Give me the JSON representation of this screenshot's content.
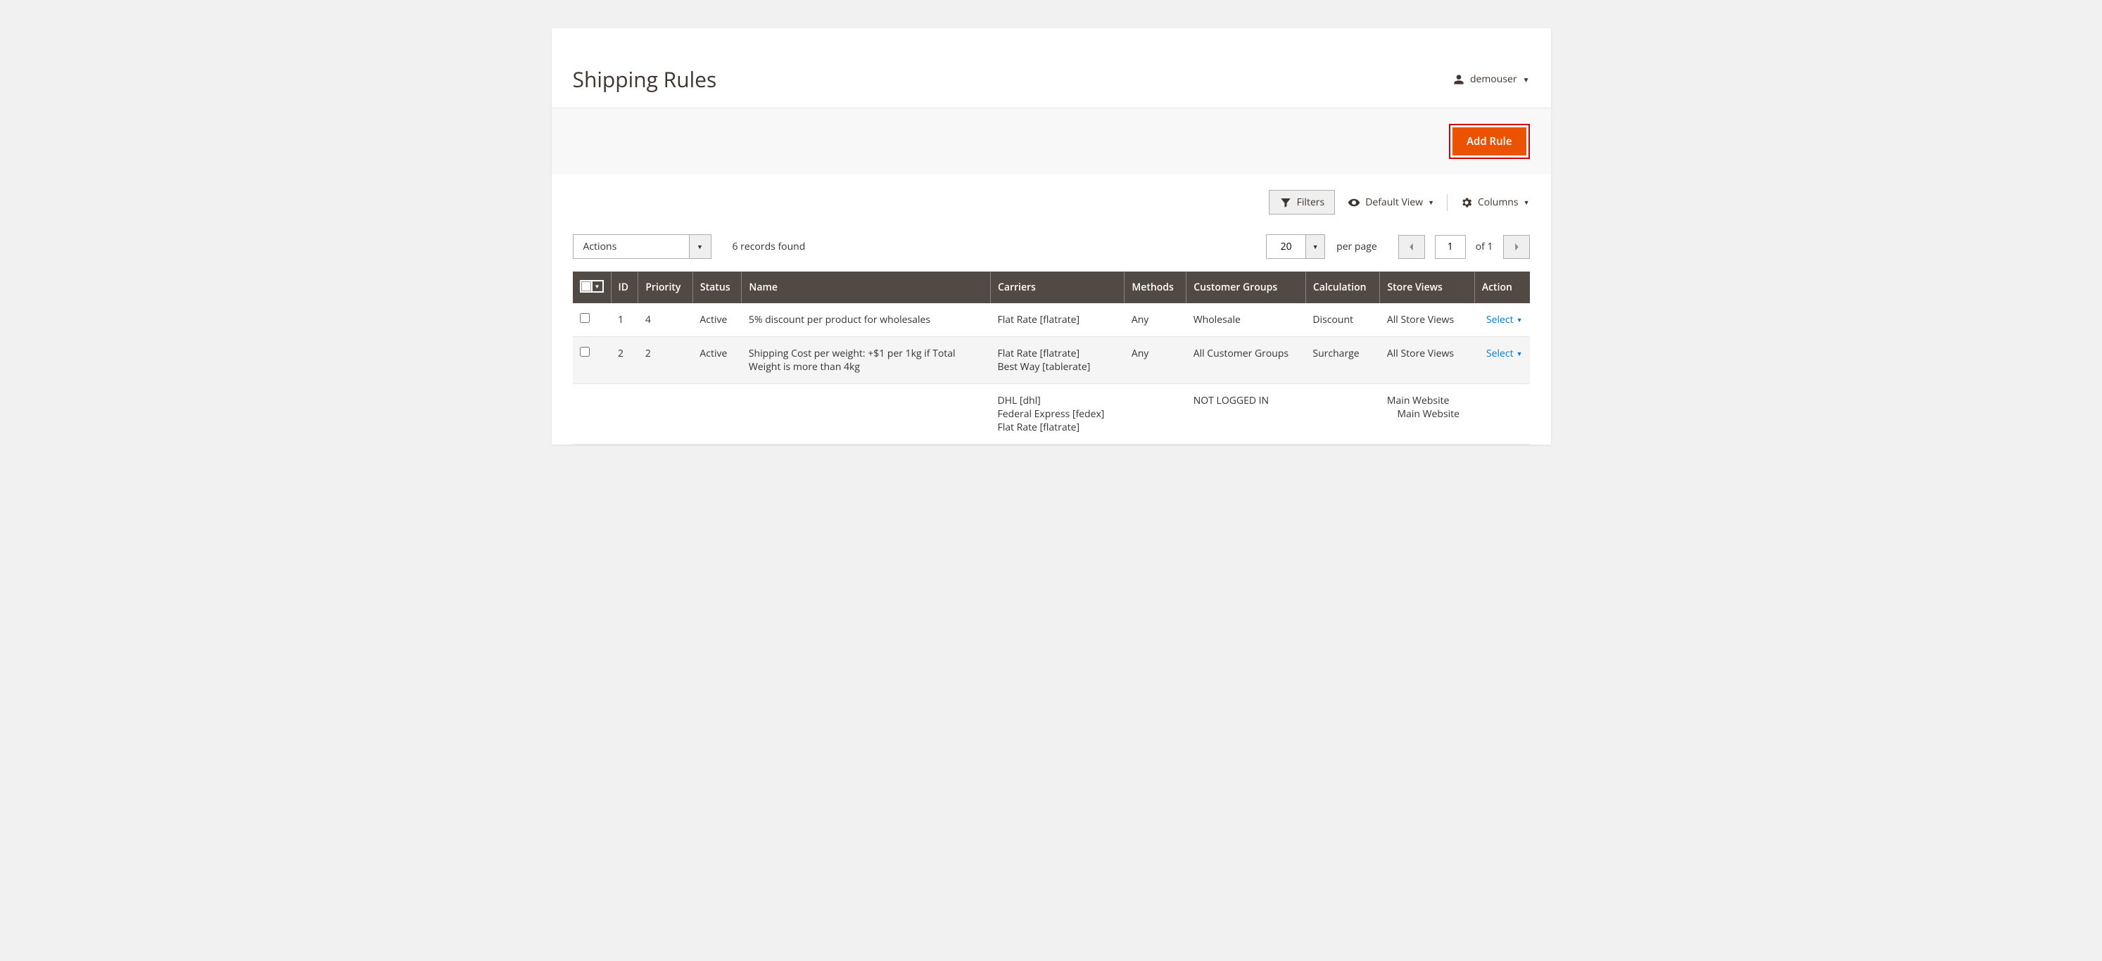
{
  "page_title": "Shipping Rules",
  "user": {
    "name": "demouser"
  },
  "action_bar": {
    "add_rule_label": "Add Rule"
  },
  "toolbar": {
    "filters_label": "Filters",
    "default_view_label": "Default View",
    "columns_label": "Columns"
  },
  "controls": {
    "actions_label": "Actions",
    "records_found": "6 records found",
    "per_page_value": "20",
    "per_page_label": "per page",
    "current_page": "1",
    "of_label": "of 1"
  },
  "columns": {
    "id": "ID",
    "priority": "Priority",
    "status": "Status",
    "name": "Name",
    "carriers": "Carriers",
    "methods": "Methods",
    "customer_groups": "Customer Groups",
    "calculation": "Calculation",
    "store_views": "Store Views",
    "action": "Action"
  },
  "rows": [
    {
      "id": "1",
      "priority": "4",
      "status": "Active",
      "name": "5% discount per product for wholesales",
      "carriers": "Flat Rate [flatrate]",
      "methods": "Any",
      "customer_groups": "Wholesale",
      "calculation": "Discount",
      "store_views": "All Store Views",
      "action": "Select"
    },
    {
      "id": "2",
      "priority": "2",
      "status": "Active",
      "name": "Shipping Cost per weight: +$1 per 1kg if Total Weight is more than 4kg",
      "carriers": "Flat Rate [flatrate]\nBest Way [tablerate]",
      "methods": "Any",
      "customer_groups": "All Customer Groups",
      "calculation": "Surcharge",
      "store_views": "All Store Views",
      "action": "Select"
    },
    {
      "id": "",
      "priority": "",
      "status": "",
      "name": "",
      "carriers": "DHL [dhl]\nFederal Express [fedex]\nFlat Rate [flatrate]",
      "methods": "",
      "customer_groups": "NOT LOGGED IN",
      "calculation": "",
      "store_views": "Main Website\n    Main Website",
      "action": ""
    }
  ]
}
